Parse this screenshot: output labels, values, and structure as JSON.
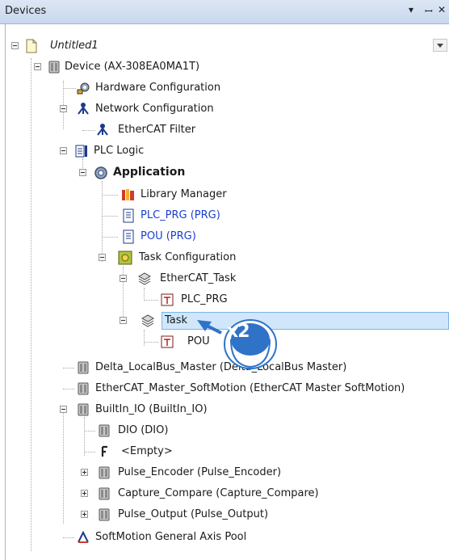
{
  "panel": {
    "title": "Devices",
    "buttons": {
      "dropdown": "▾",
      "pin": "ꟷ",
      "close": "✕"
    }
  },
  "tree": {
    "project": "Untitled1",
    "device": "Device (AX-308EA0MA1T)",
    "hardware_config": "Hardware Configuration",
    "network_config": "Network Configuration",
    "ethercat_filter": "EtherCAT Filter",
    "plc_logic": "PLC Logic",
    "application": "Application",
    "library_manager": "Library Manager",
    "plc_prg": "PLC_PRG (PRG)",
    "pou_prg": "POU (PRG)",
    "task_configuration": "Task Configuration",
    "ethercat_task": "EtherCAT_Task",
    "plc_prg_call": "PLC_PRG",
    "task": "Task",
    "pou_call": "POU",
    "delta_localbus": "Delta_LocalBus_Master (Delta_LocalBus Master)",
    "ethercat_master": "EtherCAT_Master_SoftMotion (EtherCAT Master SoftMotion)",
    "builtin_io": "BuiltIn_IO (BuiltIn_IO)",
    "dio": "DIO (DIO)",
    "empty": "<Empty>",
    "pulse_encoder": "Pulse_Encoder (Pulse_Encoder)",
    "capture_compare": "Capture_Compare (Capture_Compare)",
    "pulse_output": "Pulse_Output (Pulse_Output)",
    "softmotion_pool": "SoftMotion General Axis Pool"
  },
  "annotation": {
    "text": "x2"
  },
  "colors": {
    "link": "#1a3fd0",
    "selection": "#cfe6fb",
    "callout": "#2f73c8"
  }
}
